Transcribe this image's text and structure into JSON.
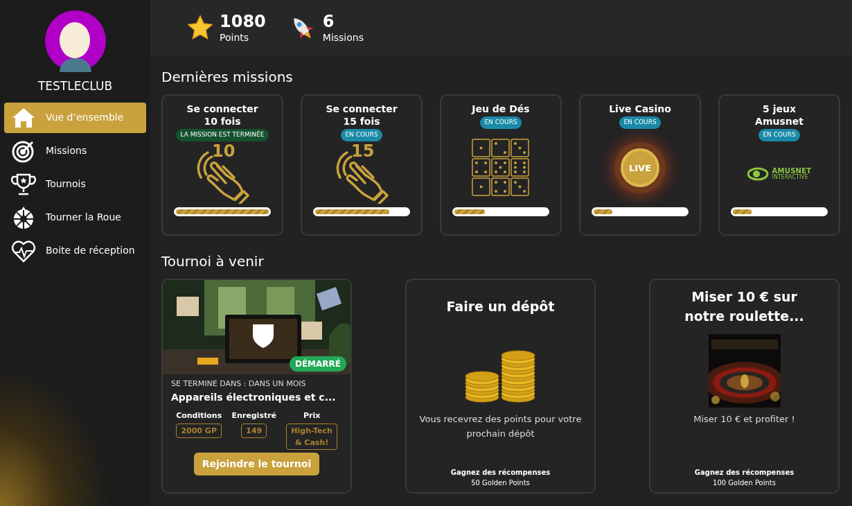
{
  "profile": {
    "username": "TESTLECLUB"
  },
  "nav": [
    {
      "label": "Vue d’ensemble",
      "selected": true
    },
    {
      "label": "Missions",
      "selected": false
    },
    {
      "label": "Tournois",
      "selected": false
    },
    {
      "label": "Tourner la Roue",
      "selected": false
    },
    {
      "label": "Boite de réception",
      "selected": false
    }
  ],
  "stats": [
    {
      "value": "1080",
      "label": "Points"
    },
    {
      "value": "6",
      "label": "Missions"
    }
  ],
  "missions_title": "Dernières missions",
  "missions": [
    {
      "title": "Se connecter\n10 fois",
      "status": "LA MISSION EST TERMINÉE",
      "done": true,
      "kind": "hand",
      "art_text": "10",
      "level": 1
    },
    {
      "title": "Se connecter\n15 fois",
      "status": "EN COURS",
      "done": false,
      "kind": "hand",
      "art_text": "15",
      "level": 0.8
    },
    {
      "title": "Jeu de Dés",
      "status": "EN COURS",
      "done": false,
      "kind": "dice",
      "level": 0.33
    },
    {
      "title": "Live Casino",
      "status": "EN COURS",
      "done": false,
      "kind": "live",
      "art_text": "LIVE",
      "level": 0.2
    },
    {
      "title": "5 jeux\nAmusnet",
      "status": "EN COURS",
      "done": false,
      "kind": "logo",
      "art_text": "AMUSNET",
      "art_subtext": "INTERACTIVE",
      "level": 0.2
    }
  ],
  "tournaments_title": "Tournoi à venir",
  "tournament": {
    "badge": "DÉMARRÉ",
    "ends": "SE TERMINE DANS : DANS UN MOIS",
    "name": "Appareils électroniques et c...",
    "details": [
      {
        "label": "Conditions",
        "value": "2000 GP"
      },
      {
        "label": "Enregistré",
        "value": "149"
      },
      {
        "label": "Prix",
        "value": "High-Tech\n& Cash!"
      }
    ],
    "button": "Rejoindre le tournoi"
  },
  "offers": [
    {
      "title": "Faire un dépôt",
      "kind": "coins",
      "text": "Vous recevrez des points pour votre prochain dépôt",
      "reward_label": "Gagnez des récompenses",
      "reward": "50 Golden Points"
    },
    {
      "title": "Miser 10 € sur\nnotre roulette...",
      "kind": "picture",
      "text": "Miser 10 € et profiter !",
      "reward_label": "Gagnez des récompenses",
      "reward": "100 Golden Points"
    }
  ]
}
